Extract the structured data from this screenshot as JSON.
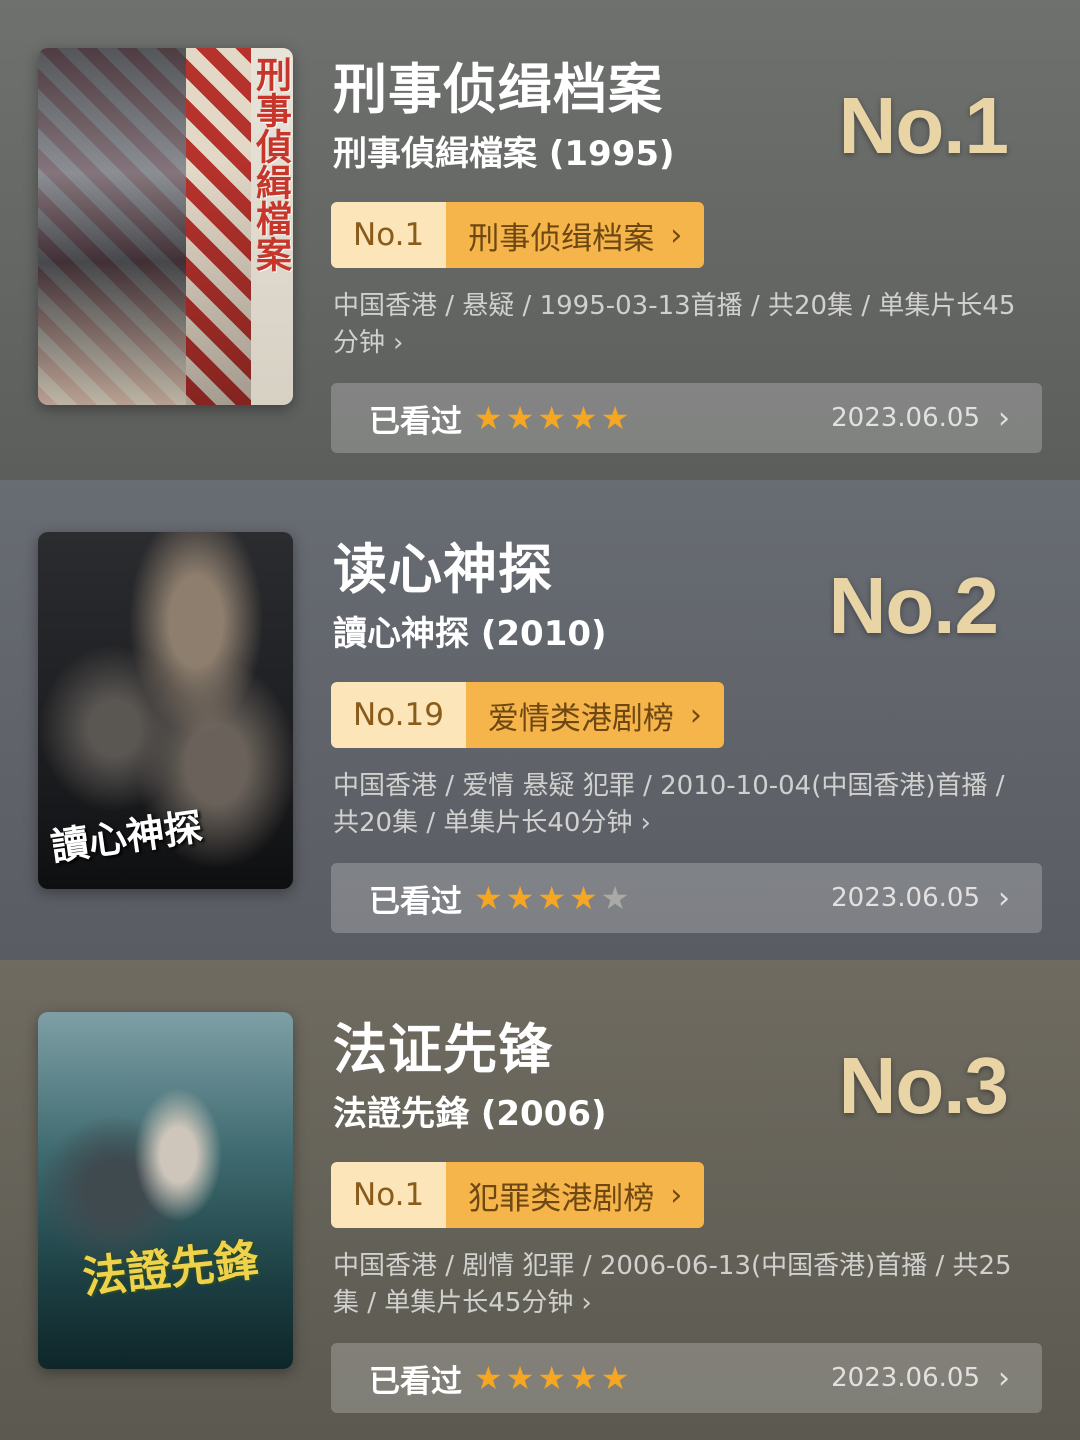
{
  "items": [
    {
      "poster_title": "刑事偵緝檔案",
      "title": "刑事侦缉档案",
      "subtitle": "刑事偵緝檔案 (1995)",
      "rank_big": "No.1",
      "chart_rank": "No.1",
      "chart_name": "刑事侦缉档案",
      "meta": "中国香港 / 悬疑 / 1995-03-13首播 / 共20集 / 单集片长45分钟",
      "watched_label": "已看过",
      "rating": 5,
      "date": "2023.06.05"
    },
    {
      "poster_title": "讀心神探",
      "title": "读心神探",
      "subtitle": "讀心神探 (2010)",
      "rank_big": "No.2",
      "chart_rank": "No.19",
      "chart_name": "爱情类港剧榜",
      "meta": "中国香港 / 爱情 悬疑 犯罪 / 2010-10-04(中国香港)首播 / 共20集 / 单集片长40分钟",
      "watched_label": "已看过",
      "rating": 4,
      "date": "2023.06.05"
    },
    {
      "poster_title": "法證先鋒",
      "title": "法证先锋",
      "subtitle": "法證先鋒 (2006)",
      "rank_big": "No.3",
      "chart_rank": "No.1",
      "chart_name": "犯罪类港剧榜",
      "meta": "中国香港 / 剧情 犯罪 / 2006-06-13(中国香港)首播 / 共25集 / 单集片长45分钟",
      "watched_label": "已看过",
      "rating": 5,
      "date": "2023.06.05"
    }
  ],
  "rating_max": 5,
  "icons": {
    "chevron": "chevron-right-icon",
    "star": "star-icon"
  },
  "colors": {
    "star_on": "#f5a623",
    "star_off": "#a9a9a6",
    "badge_rank_bg": "#fbe5b9",
    "badge_list_bg": "#f6b54b",
    "rank_big": "#e9d4a6"
  }
}
